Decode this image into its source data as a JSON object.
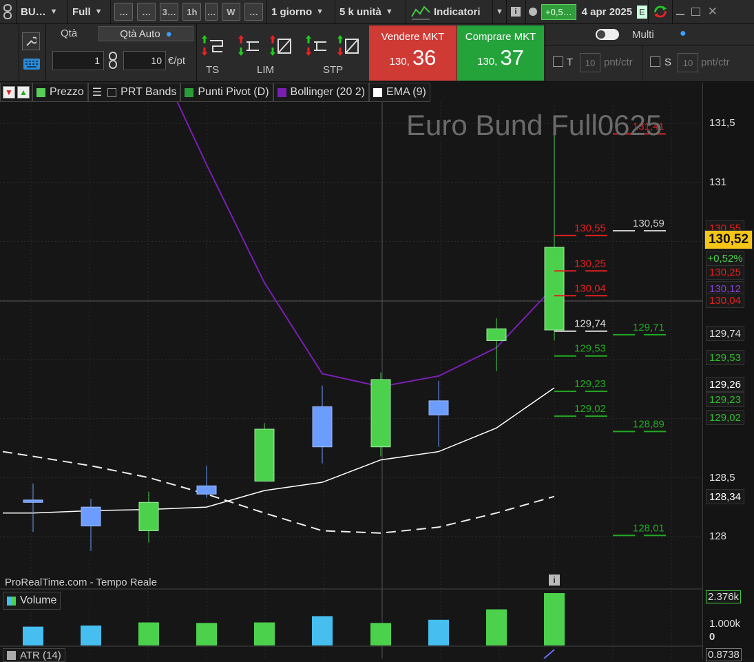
{
  "topbar": {
    "instrument": "BU…",
    "view_mode": "Full",
    "period_buttons": [
      "…",
      "…",
      "3…",
      "1h",
      "…",
      "W",
      "…"
    ],
    "timeframe": "1 giorno",
    "units": "5 k unità",
    "indicators_label": "Indicatori",
    "change_badge": "+0,5…",
    "date": "4 apr 2025",
    "e_button": "E"
  },
  "order_panel": {
    "qty_label": "Qtà",
    "qty_auto_label": "Qtà Auto",
    "qty_value": "1",
    "value_per_point": "10",
    "unit_label": "€/pt",
    "ts_label": "TS",
    "lim_label": "LIM",
    "stp_label": "STP",
    "sell_label": "Vendere MKT",
    "sell_price_prefix": "130,",
    "sell_price_main": "36",
    "buy_label": "Comprare MKT",
    "buy_price_prefix": "130,",
    "buy_price_main": "37",
    "multi_label": "Multi",
    "t_label": "T",
    "t_value": "10",
    "t_unit": "pnt/ctr",
    "s_label": "S",
    "s_value": "10",
    "s_unit": "pnt/ctr"
  },
  "indicator_bar": {
    "items": [
      {
        "label": "Prezzo",
        "color": "#58d058"
      },
      {
        "label": "PRT Bands",
        "color": ""
      },
      {
        "label": "Punti Pivot (D)",
        "color": "#2a9d3a"
      },
      {
        "label": "Bollinger (20 2)",
        "color": "#7a1fb5"
      },
      {
        "label": "EMA (9)",
        "color": "#ffffff"
      }
    ]
  },
  "chart_meta": {
    "watermark": "Euro Bund Full0625",
    "credit": "ProRealTime.com - Tempo Reale",
    "volume_label": "Volume",
    "atr_label": "ATR (14)",
    "info_marker": "i"
  },
  "price_axis": {
    "ticks": [
      "131,5",
      "131",
      "128,5",
      "128"
    ],
    "current_price": "130,52",
    "current_change": "+0,52%",
    "tags": [
      {
        "text": "130,55",
        "color": "#e02020"
      },
      {
        "text": "130,25",
        "color": "#e02020"
      },
      {
        "text": "130,12",
        "color": "#8a3fd0"
      },
      {
        "text": "130,04",
        "color": "#e02020"
      },
      {
        "text": "129,74",
        "color": "#dddddd"
      },
      {
        "text": "129,53",
        "color": "#33bb33"
      },
      {
        "text": "129,26",
        "color": "#ffffff"
      },
      {
        "text": "129,23",
        "color": "#33bb33"
      },
      {
        "text": "129,02",
        "color": "#33bb33"
      },
      {
        "text": "128,34",
        "color": "#ffffff"
      }
    ],
    "volume_ticks": [
      "2.376k",
      "1.000k",
      "0"
    ],
    "atr_value": "0.8738"
  },
  "pivot_labels": [
    {
      "text": "131,41",
      "color": "#e02020"
    },
    {
      "text": "130,55",
      "color": "#e02020"
    },
    {
      "text": "130,59",
      "color": "#cccccc"
    },
    {
      "text": "130,25",
      "color": "#e02020"
    },
    {
      "text": "130,04",
      "color": "#e02020"
    },
    {
      "text": "129,74",
      "color": "#dddddd"
    },
    {
      "text": "129,71",
      "color": "#22aa22"
    },
    {
      "text": "129,53",
      "color": "#22aa22"
    },
    {
      "text": "129,23",
      "color": "#22aa22"
    },
    {
      "text": "129,02",
      "color": "#22aa22"
    },
    {
      "text": "128,89",
      "color": "#22aa22"
    },
    {
      "text": "128,01",
      "color": "#22aa22"
    }
  ],
  "chart_data": {
    "type": "candlestick",
    "candles": [
      {
        "o": 128.31,
        "h": 128.45,
        "l": 128.04,
        "c": 128.29,
        "dir": "flat"
      },
      {
        "o": 128.25,
        "h": 128.32,
        "l": 127.88,
        "c": 128.09,
        "dir": "down"
      },
      {
        "o": 128.05,
        "h": 128.38,
        "l": 127.95,
        "c": 128.29,
        "dir": "up"
      },
      {
        "o": 128.43,
        "h": 128.6,
        "l": 128.33,
        "c": 128.36,
        "dir": "down"
      },
      {
        "o": 128.47,
        "h": 128.96,
        "l": 128.47,
        "c": 128.91,
        "dir": "up"
      },
      {
        "o": 129.1,
        "h": 129.28,
        "l": 128.62,
        "c": 128.76,
        "dir": "down"
      },
      {
        "o": 128.76,
        "h": 129.39,
        "l": 128.68,
        "c": 129.33,
        "dir": "up"
      },
      {
        "o": 129.15,
        "h": 129.32,
        "l": 128.76,
        "c": 129.03,
        "dir": "down"
      },
      {
        "o": 129.66,
        "h": 129.85,
        "l": 129.4,
        "c": 129.76,
        "dir": "up"
      },
      {
        "o": 129.75,
        "h": 131.45,
        "l": 129.66,
        "c": 130.45,
        "dir": "up"
      }
    ],
    "ema9": [
      128.2,
      128.22,
      128.23,
      128.25,
      128.39,
      128.46,
      128.65,
      128.72,
      128.92,
      129.26
    ],
    "bollinger_upper": [
      133.6,
      133.2,
      132.2,
      131.15,
      130.15,
      129.38,
      129.27,
      129.36,
      129.6,
      130.12
    ],
    "bollinger_lower": [
      128.68,
      128.6,
      128.5,
      128.36,
      128.2,
      128.05,
      128.03,
      128.08,
      128.2,
      128.34
    ],
    "volume": [
      0.36,
      0.38,
      0.44,
      0.43,
      0.44,
      0.56,
      0.43,
      0.49,
      0.69,
      1.0
    ],
    "volume_colors": [
      "#46bff0",
      "#46bff0",
      "#4cd14c",
      "#4cd14c",
      "#4cd14c",
      "#46bff0",
      "#4cd14c",
      "#46bff0",
      "#4cd14c",
      "#4cd14c"
    ],
    "ylim": [
      127.7,
      131.6
    ]
  }
}
